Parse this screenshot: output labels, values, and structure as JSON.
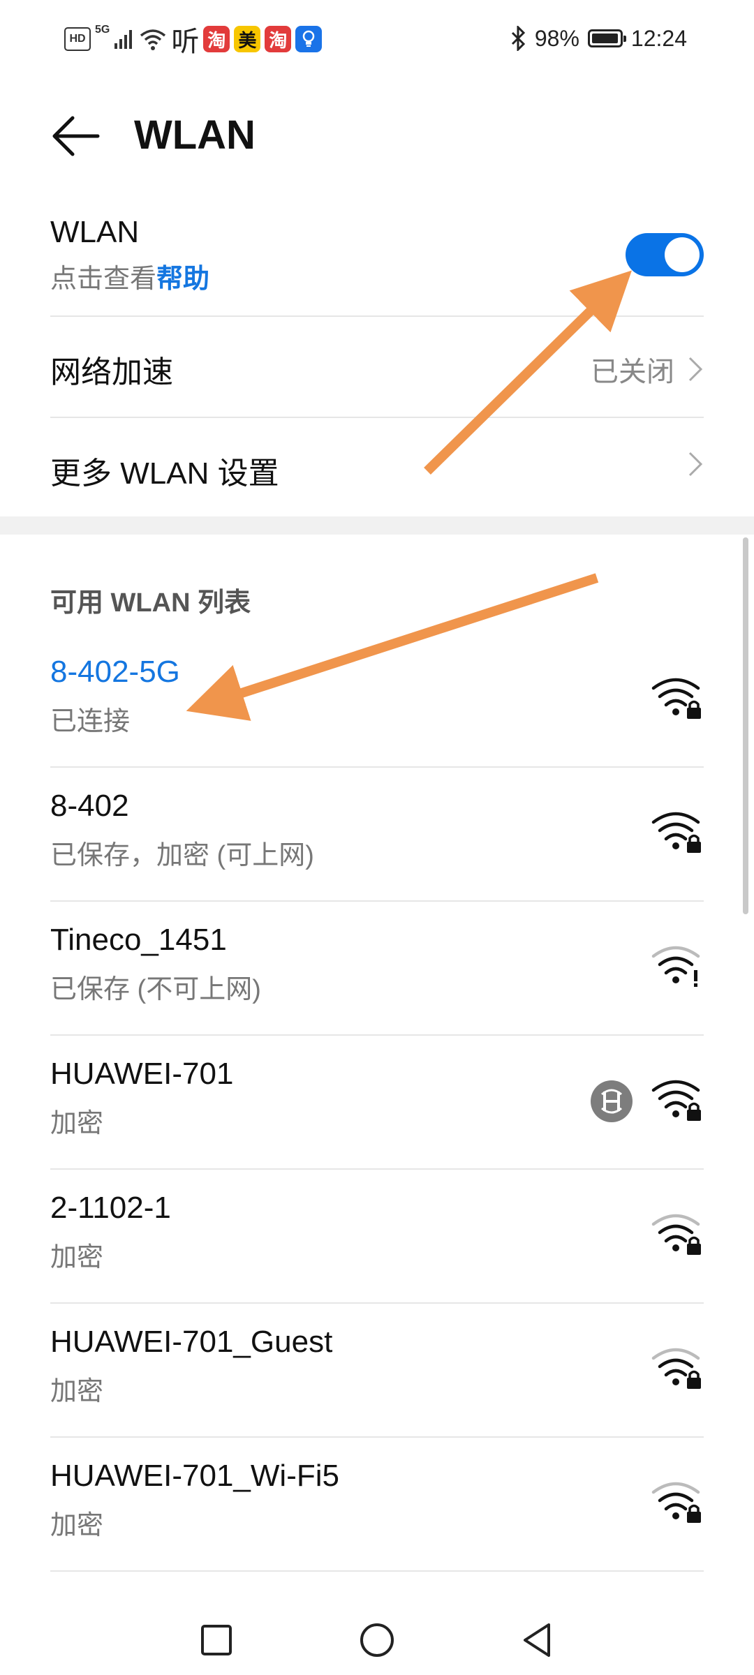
{
  "status_bar": {
    "hd": "HD",
    "network": "5G",
    "app_icons": [
      {
        "glyph": "淘",
        "color": "#e23b3b",
        "text_color": "#ffffff"
      },
      {
        "glyph": "美",
        "color": "#f7c600",
        "text_color": "#111111"
      },
      {
        "glyph": "淘",
        "color": "#e23b3b",
        "text_color": "#ffffff"
      }
    ],
    "ting_glyph": "听",
    "battery": "98%",
    "battery_level": 0.98,
    "time": "12:24"
  },
  "header": {
    "title": "WLAN"
  },
  "wlan_toggle": {
    "label": "WLAN",
    "sub_prefix": "点击查看",
    "sub_link": "帮助",
    "on": true
  },
  "network_accel": {
    "label": "网络加速",
    "value": "已关闭"
  },
  "more_settings": {
    "label": "更多 WLAN 设置"
  },
  "available_list": {
    "title": "可用 WLAN 列表",
    "networks": [
      {
        "name": "8-402-5G",
        "status": "已连接",
        "connected": true,
        "signal": "full-lock",
        "hilink": false
      },
      {
        "name": "8-402",
        "status": "已保存，加密 (可上网)",
        "connected": false,
        "signal": "full-lock",
        "hilink": false
      },
      {
        "name": "Tineco_1451",
        "status": "已保存 (不可上网)",
        "connected": false,
        "signal": "weak-exclaim",
        "hilink": false
      },
      {
        "name": "HUAWEI-701",
        "status": "加密",
        "connected": false,
        "signal": "full-lock",
        "hilink": true
      },
      {
        "name": "2-1102-1",
        "status": "加密",
        "connected": false,
        "signal": "weak-lock",
        "hilink": false
      },
      {
        "name": "HUAWEI-701_Guest",
        "status": "加密",
        "connected": false,
        "signal": "weak-lock",
        "hilink": false
      },
      {
        "name": "HUAWEI-701_Wi-Fi5",
        "status": "加密",
        "connected": false,
        "signal": "weak-lock",
        "hilink": false
      }
    ]
  },
  "colors": {
    "accent": "#1476e0",
    "toggle_on": "#0a73e6",
    "annotation_arrow": "#f0954c"
  }
}
